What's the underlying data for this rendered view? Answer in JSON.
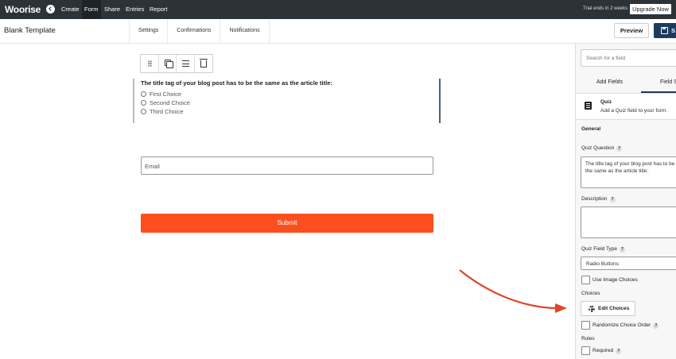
{
  "topbar": {
    "logo": "Woorise",
    "nav": [
      "Create",
      "Form",
      "Share",
      "Entries",
      "Report"
    ],
    "active_nav": "Form",
    "trial_text": "Trial ends in 2 weeks",
    "upgrade_label": "Upgrade Now"
  },
  "header": {
    "form_title": "Blank Template",
    "tabs": [
      "Settings",
      "Confirmations",
      "Notifications"
    ],
    "preview_label": "Preview",
    "save_label": "S"
  },
  "form": {
    "quiz_question": "The title tag of your blog post has to be the same as the article title:",
    "choices": [
      "First Choice",
      "Second Choice",
      "Third Choice"
    ],
    "email_placeholder": "Email",
    "submit_label": "Submit"
  },
  "sidebar": {
    "search_placeholder": "Search for a field",
    "tabs": [
      "Add Fields",
      "Field S"
    ],
    "active_tab": "Field S",
    "field_title": "Quiz",
    "field_desc": "Add a Quiz field to your form.",
    "general_label": "General",
    "quiz_question_label": "Quiz Question",
    "quiz_question_value": "The title tag of your blog post has to be the same as the article title:",
    "description_label": "Description",
    "description_value": "",
    "field_type_label": "Quiz Field Type",
    "field_type_value": "Radio Buttons",
    "use_image_choices": "Use Image Choices",
    "choices_label": "Choices",
    "edit_choices_label": "Edit Choices",
    "randomize_label": "Randomize Choice Order",
    "rules_label": "Rules",
    "required_label": "Required",
    "help_glyph": "?"
  },
  "colors": {
    "topbar": "#2c3338",
    "submit": "#fc4f1f",
    "primary": "#1e3a5f",
    "arrow": "#e0452a"
  }
}
